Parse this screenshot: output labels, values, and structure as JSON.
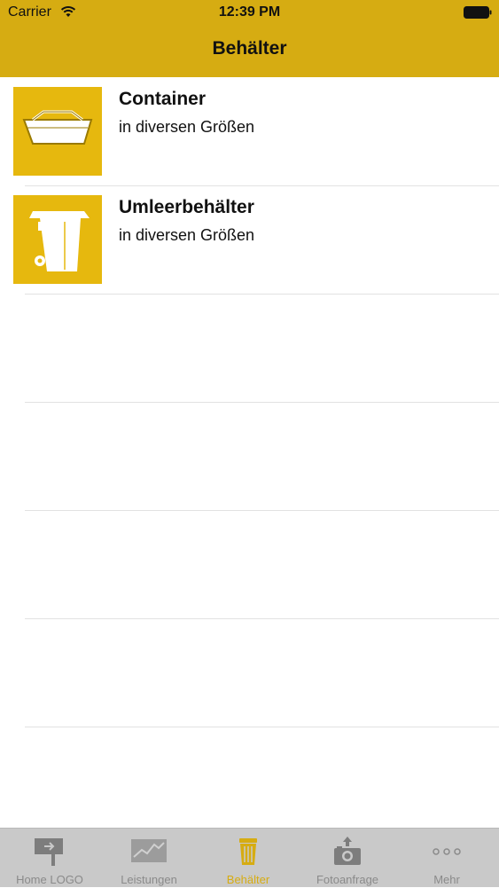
{
  "status_bar": {
    "carrier": "Carrier",
    "time": "12:39 PM"
  },
  "nav": {
    "title": "Behälter"
  },
  "list": {
    "items": [
      {
        "title": "Container",
        "subtitle": "in diversen Größen",
        "icon": "skip-container-icon"
      },
      {
        "title": "Umleerbehälter",
        "subtitle": "in diversen Größen",
        "icon": "wheelie-bin-icon"
      }
    ]
  },
  "tabs": [
    {
      "label": "Home LOGO",
      "icon": "signpost-icon",
      "active": false
    },
    {
      "label": "Leistungen",
      "icon": "chart-icon",
      "active": false
    },
    {
      "label": "Behälter",
      "icon": "bin-icon",
      "active": true
    },
    {
      "label": "Fotoanfrage",
      "icon": "camera-upload-icon",
      "active": false
    },
    {
      "label": "Mehr",
      "icon": "more-dots-icon",
      "active": false
    }
  ],
  "colors": {
    "header": "#d6ac12",
    "thumb": "#e6b80e",
    "tab_active": "#d6ac12",
    "tab_inactive": "#8a8a8a",
    "tabbar_bg": "#c9c9c9"
  }
}
